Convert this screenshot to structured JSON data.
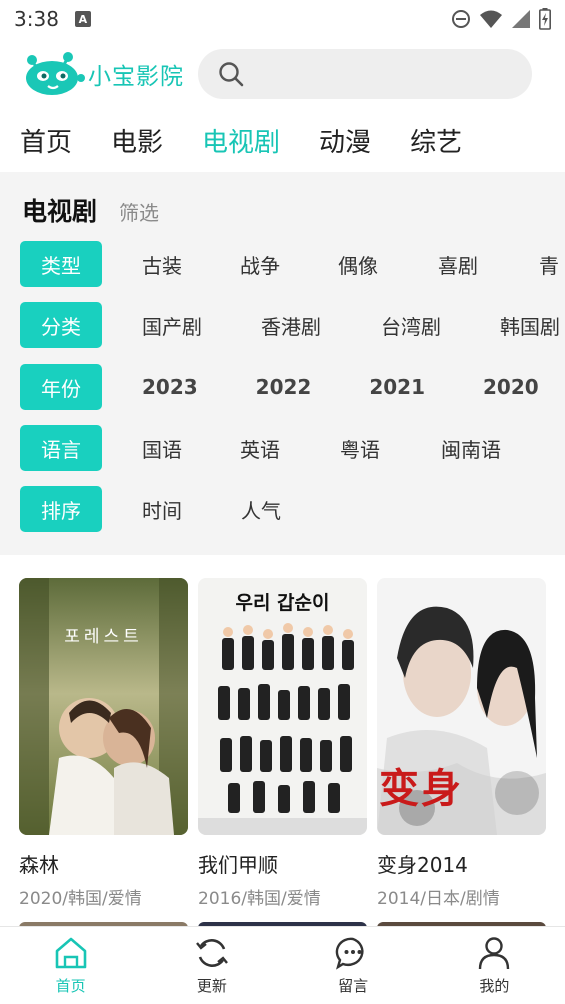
{
  "status_bar": {
    "time": "3:38"
  },
  "app": {
    "name": "小宝影院"
  },
  "search": {
    "placeholder": ""
  },
  "top_tabs": [
    "首页",
    "电影",
    "电视剧",
    "动漫",
    "综艺"
  ],
  "filter": {
    "title": "电视剧",
    "subtitle": "筛选",
    "rows": [
      {
        "label": "类型",
        "options": [
          "古装",
          "战争",
          "偶像",
          "喜剧",
          "青"
        ]
      },
      {
        "label": "分类",
        "options": [
          "国产剧",
          "香港剧",
          "台湾剧",
          "韩国剧"
        ]
      },
      {
        "label": "年份",
        "options": [
          "2023",
          "2022",
          "2021",
          "2020"
        ]
      },
      {
        "label": "语言",
        "options": [
          "国语",
          "英语",
          "粤语",
          "闽南语"
        ]
      },
      {
        "label": "排序",
        "options": [
          "时间",
          "人气"
        ]
      }
    ]
  },
  "movies": [
    {
      "title": "森林",
      "meta": "2020/韩国/爱情",
      "poster_text": "포레스트"
    },
    {
      "title": "我们甲顺",
      "meta": "2016/韩国/爱情",
      "poster_text": "우리 갑순이"
    },
    {
      "title": "变身2014",
      "meta": "2014/日本/剧情",
      "poster_text": "变身"
    }
  ],
  "bottom_nav": [
    {
      "label": "首页",
      "icon": "home-icon"
    },
    {
      "label": "更新",
      "icon": "refresh-icon"
    },
    {
      "label": "留言",
      "icon": "message-icon"
    },
    {
      "label": "我的",
      "icon": "user-icon"
    }
  ],
  "colors": {
    "accent": "#19d0bf",
    "filter_bg": "#f4f4f4"
  }
}
